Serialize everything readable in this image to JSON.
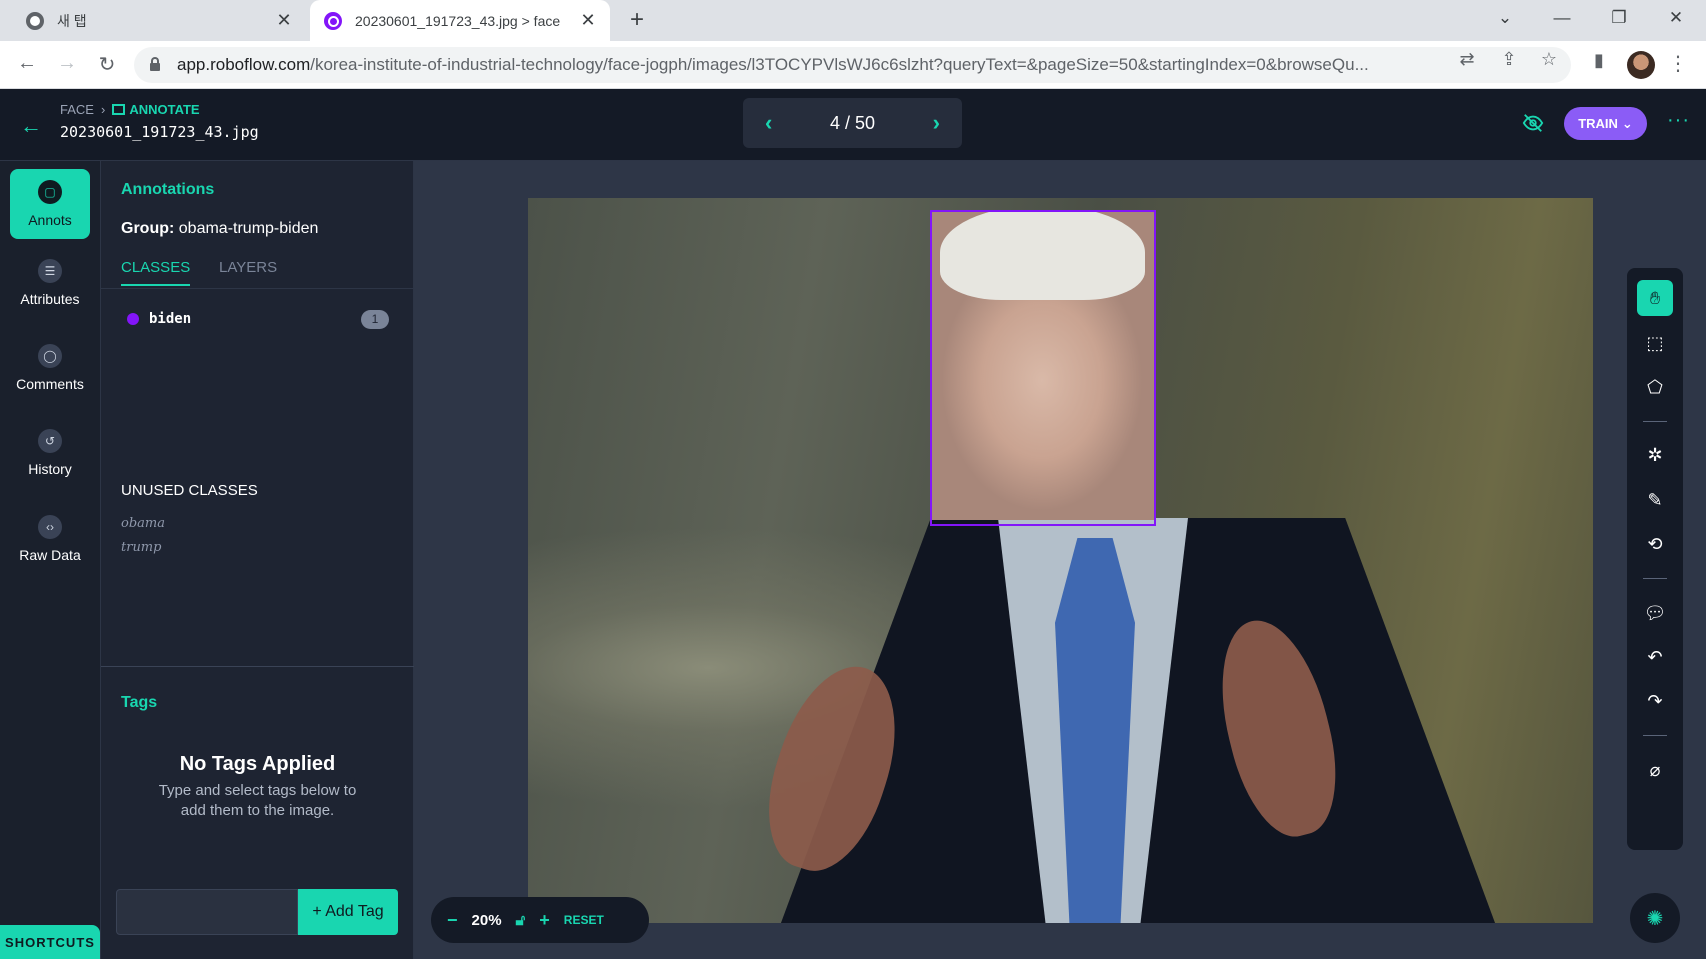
{
  "browser": {
    "tabs": [
      {
        "title": "새 탭"
      },
      {
        "title": "20230601_191723_43.jpg > face"
      }
    ],
    "url_host": "app.roboflow.com",
    "url_path": "/korea-institute-of-industrial-technology/face-jogph/images/l3TOCYPVlsWJ6c6slzht?queryText=&pageSize=50&startingIndex=0&browseQu..."
  },
  "header": {
    "breadcrumb_project": "FACE",
    "breadcrumb_section": "ANNOTATE",
    "filename": "20230601_191723_43.jpg",
    "pager": "4 / 50",
    "train_label": "TRAIN"
  },
  "rail": {
    "items": [
      {
        "label": "Annots",
        "icon": "annotation-icon"
      },
      {
        "label": "Attributes",
        "icon": "list-icon"
      },
      {
        "label": "Comments",
        "icon": "comment-icon"
      },
      {
        "label": "History",
        "icon": "history-icon"
      },
      {
        "label": "Raw Data",
        "icon": "code-icon"
      }
    ],
    "shortcuts_label": "SHORTCUTS"
  },
  "panel": {
    "title": "Annotations",
    "group_label": "Group:",
    "group_value": "obama-trump-biden",
    "tabs": [
      "CLASSES",
      "LAYERS"
    ],
    "classes": [
      {
        "name": "biden",
        "count": "1",
        "color": "#8315f9"
      }
    ],
    "unused_title": "UNUSED CLASSES",
    "unused": [
      "obama",
      "trump"
    ],
    "tags_title": "Tags",
    "tags_empty_heading": "No Tags Applied",
    "tags_empty_desc_1": "Type and select tags below to",
    "tags_empty_desc_2": "add them to the image.",
    "add_tag_label": "+ Add Tag"
  },
  "canvas": {
    "zoom": "20%",
    "reset_label": "RESET"
  },
  "colors": {
    "accent": "#19d6b0",
    "class_biden": "#8315f9",
    "train": "#8b5cf6"
  }
}
